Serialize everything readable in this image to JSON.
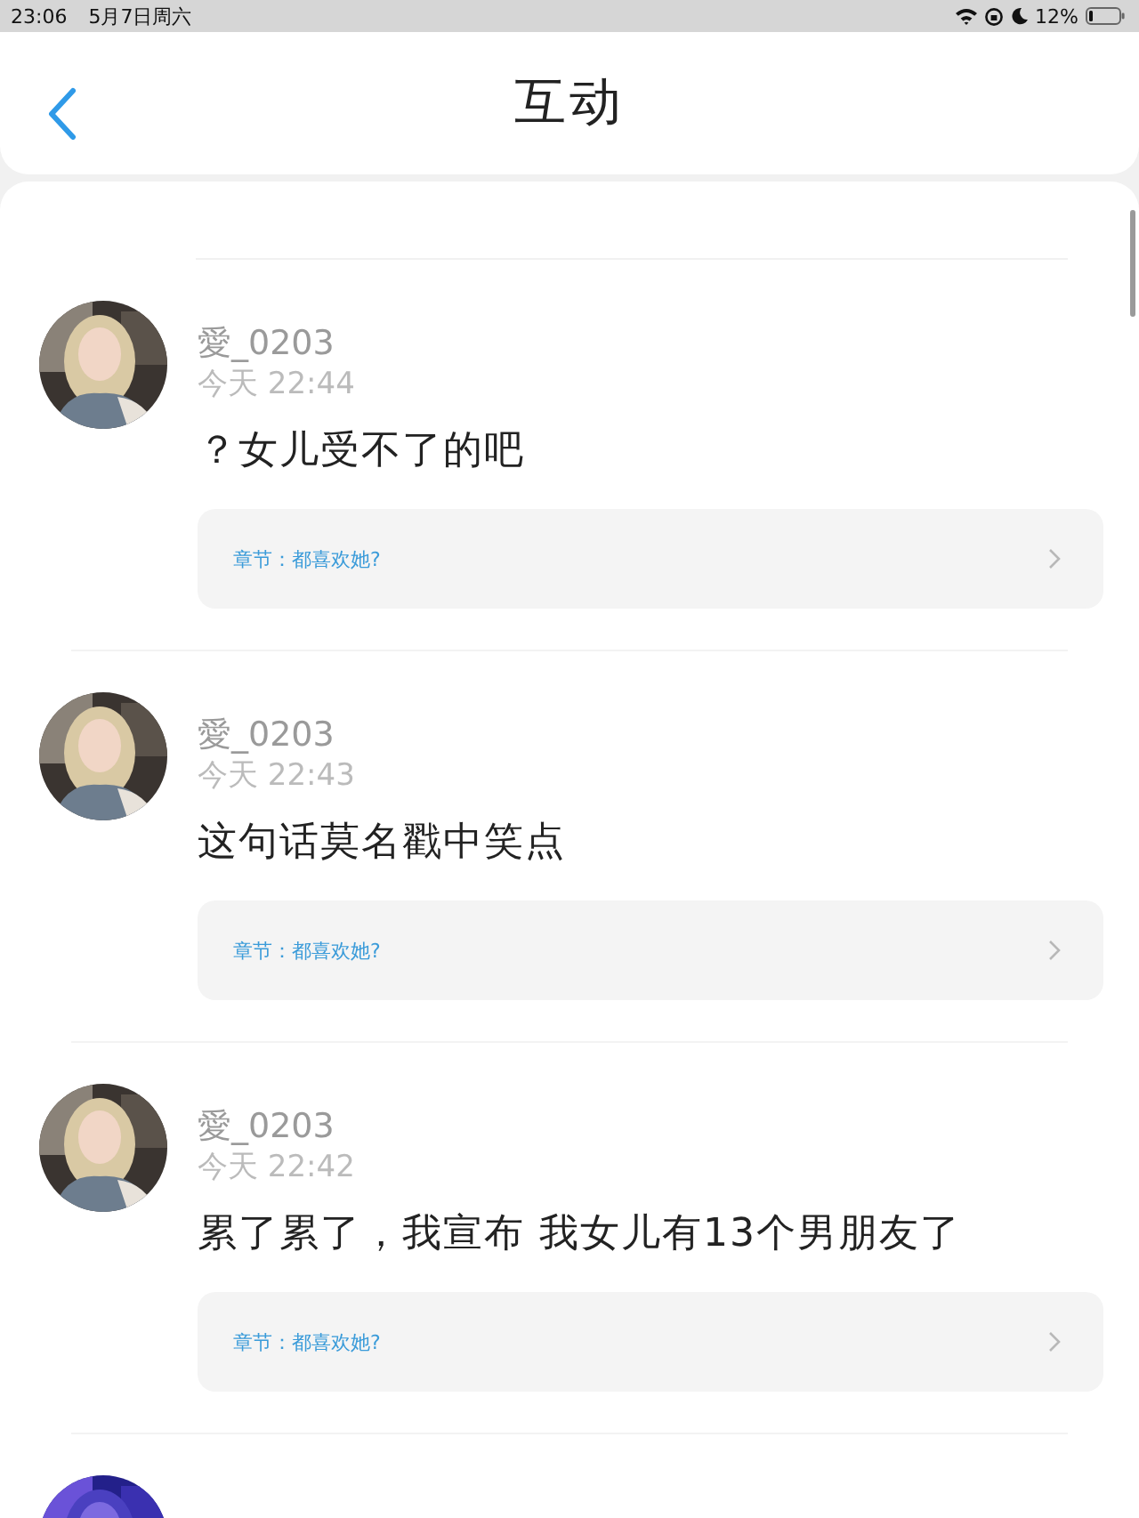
{
  "status_bar": {
    "time": "23:06",
    "date": "5月7日周六",
    "battery": "12%"
  },
  "header": {
    "title": "互动"
  },
  "comments": [
    {
      "user": "愛_0203",
      "time": "今天 22:44",
      "text": "？女儿受不了的吧",
      "chapter": "章节：都喜欢她?"
    },
    {
      "user": "愛_0203",
      "time": "今天 22:43",
      "text": "这句话莫名戳中笑点",
      "chapter": "章节：都喜欢她?"
    },
    {
      "user": "愛_0203",
      "time": "今天 22:42",
      "text": "累了累了，我宣布 我女儿有13个男朋友了",
      "chapter": "章节：都喜欢她?"
    }
  ]
}
